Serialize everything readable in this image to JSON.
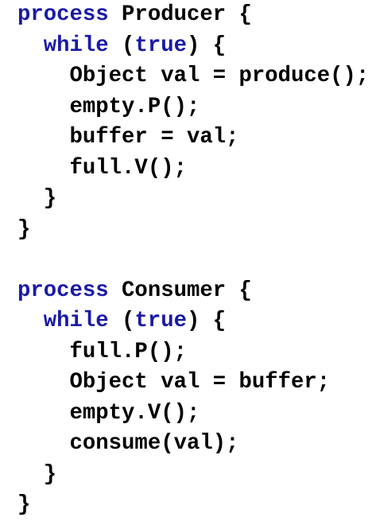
{
  "colors": {
    "keyword": "#1a1aa6",
    "text": "#000000",
    "background": "#ffffff"
  },
  "blocks": [
    {
      "lines": [
        {
          "indent": "",
          "parts": [
            {
              "t": "process",
              "kw": true
            },
            {
              "t": " Producer {",
              "kw": false
            }
          ]
        },
        {
          "indent": "  ",
          "parts": [
            {
              "t": "while",
              "kw": true
            },
            {
              "t": " (",
              "kw": false
            },
            {
              "t": "true",
              "kw": true
            },
            {
              "t": ") {",
              "kw": false
            }
          ]
        },
        {
          "indent": "    ",
          "parts": [
            {
              "t": "Object val = produce();",
              "kw": false
            }
          ]
        },
        {
          "indent": "    ",
          "parts": [
            {
              "t": "empty.P();",
              "kw": false
            }
          ]
        },
        {
          "indent": "    ",
          "parts": [
            {
              "t": "buffer = val;",
              "kw": false
            }
          ]
        },
        {
          "indent": "    ",
          "parts": [
            {
              "t": "full.V();",
              "kw": false
            }
          ]
        },
        {
          "indent": "  ",
          "parts": [
            {
              "t": "}",
              "kw": false
            }
          ]
        },
        {
          "indent": "",
          "parts": [
            {
              "t": "}",
              "kw": false
            }
          ]
        }
      ]
    },
    {
      "lines": [
        {
          "indent": "",
          "parts": [
            {
              "t": "process",
              "kw": true
            },
            {
              "t": " Consumer {",
              "kw": false
            }
          ]
        },
        {
          "indent": "  ",
          "parts": [
            {
              "t": "while",
              "kw": true
            },
            {
              "t": " (",
              "kw": false
            },
            {
              "t": "true",
              "kw": true
            },
            {
              "t": ") {",
              "kw": false
            }
          ]
        },
        {
          "indent": "    ",
          "parts": [
            {
              "t": "full.P();",
              "kw": false
            }
          ]
        },
        {
          "indent": "    ",
          "parts": [
            {
              "t": "Object val = buffer;",
              "kw": false
            }
          ]
        },
        {
          "indent": "    ",
          "parts": [
            {
              "t": "empty.V();",
              "kw": false
            }
          ]
        },
        {
          "indent": "    ",
          "parts": [
            {
              "t": "consume(val);",
              "kw": false
            }
          ]
        },
        {
          "indent": "  ",
          "parts": [
            {
              "t": "}",
              "kw": false
            }
          ]
        },
        {
          "indent": "",
          "parts": [
            {
              "t": "}",
              "kw": false
            }
          ]
        }
      ]
    }
  ]
}
